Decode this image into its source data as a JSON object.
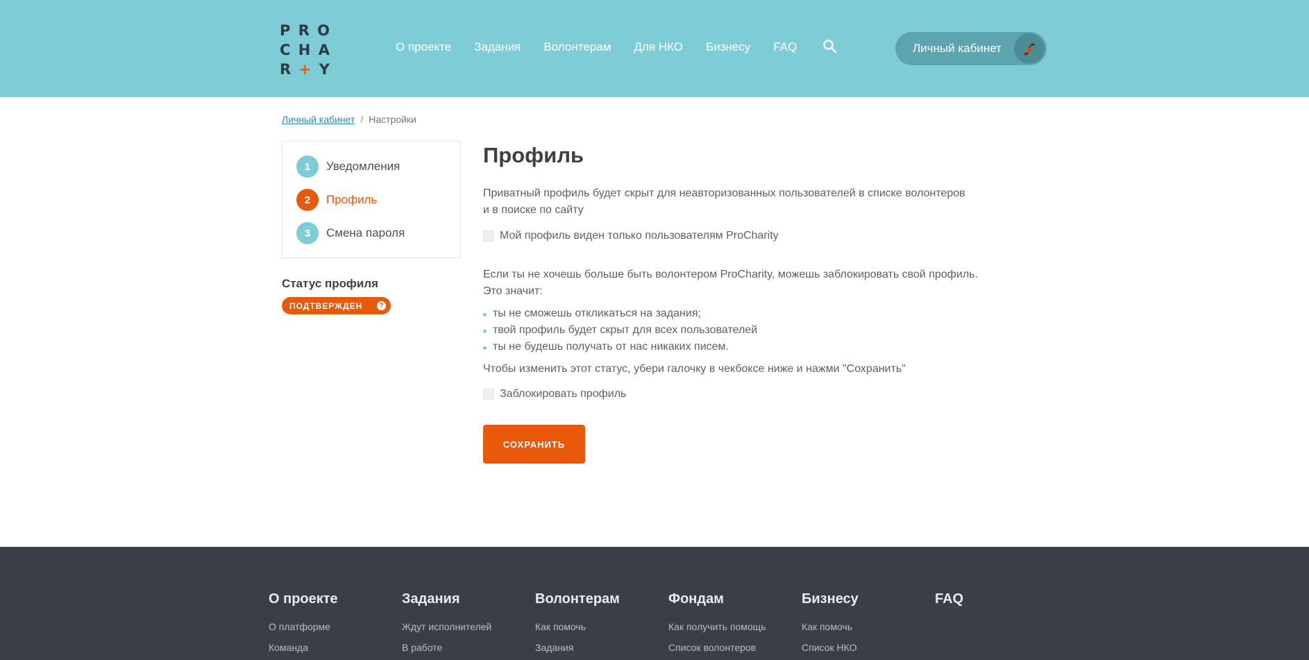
{
  "brand": {
    "logo_rows": [
      [
        "P",
        "R",
        "O"
      ],
      [
        "C",
        "H",
        "A"
      ],
      [
        "R",
        "+",
        "Y"
      ]
    ],
    "accent": "#e8590c",
    "header_bg": "#7ecdd6"
  },
  "nav": {
    "items": [
      "О проекте",
      "Задания",
      "Волонтерам",
      "Для НКО",
      "Бизнесу",
      "FAQ"
    ],
    "search_icon": "search-icon",
    "cabinet_label": "Личный кабинет"
  },
  "breadcrumb": {
    "parent": "Личный кабинет",
    "separator": "/",
    "current": "Настройки"
  },
  "sidemenu": {
    "items": [
      {
        "num": "1",
        "label": "Уведомления",
        "active": false
      },
      {
        "num": "2",
        "label": "Профиль",
        "active": true
      },
      {
        "num": "3",
        "label": "Смена пароля",
        "active": false
      }
    ]
  },
  "status": {
    "title": "Статус профиля",
    "badge": "ПОДТВЕРЖДЕН",
    "help": "?"
  },
  "main": {
    "title": "Профиль",
    "private_text_1": "Приватный профиль будет скрыт для неавторизованных пользователей в списке волонтеров",
    "private_text_2": "и в поиске по сайту",
    "private_checkbox": "Мой профиль виден только пользователям ProCharity",
    "block_text_1": "Если ты не хочешь больше быть волонтером ProCharity, можешь заблокировать свой профиль.",
    "block_text_2": "Это значит:",
    "bullets": [
      "ты не сможешь откликаться на задания;",
      "твой профиль будет скрыт для всех пользователей",
      "ты не будешь получать от нас никаких писем."
    ],
    "change_text": "Чтобы изменить этот статус, убери галочку в чекбоксе ниже и нажми \"Сохранить\"",
    "block_checkbox": "Заблокировать профиль",
    "save_label": "СОХРАНИТЬ"
  },
  "footer": {
    "columns": [
      {
        "head": "О проекте",
        "links": [
          "О платформе",
          "Команда"
        ]
      },
      {
        "head": "Задания",
        "links": [
          "Ждут исполнителей",
          "В работе"
        ]
      },
      {
        "head": "Волонтерам",
        "links": [
          "Как помочь",
          "Задания"
        ]
      },
      {
        "head": "Фондам",
        "links": [
          "Как получить помощь",
          "Список волонтеров"
        ]
      },
      {
        "head": "Бизнесу",
        "links": [
          "Как помочь",
          "Список НКО"
        ]
      },
      {
        "head": "FAQ",
        "links": []
      }
    ]
  }
}
